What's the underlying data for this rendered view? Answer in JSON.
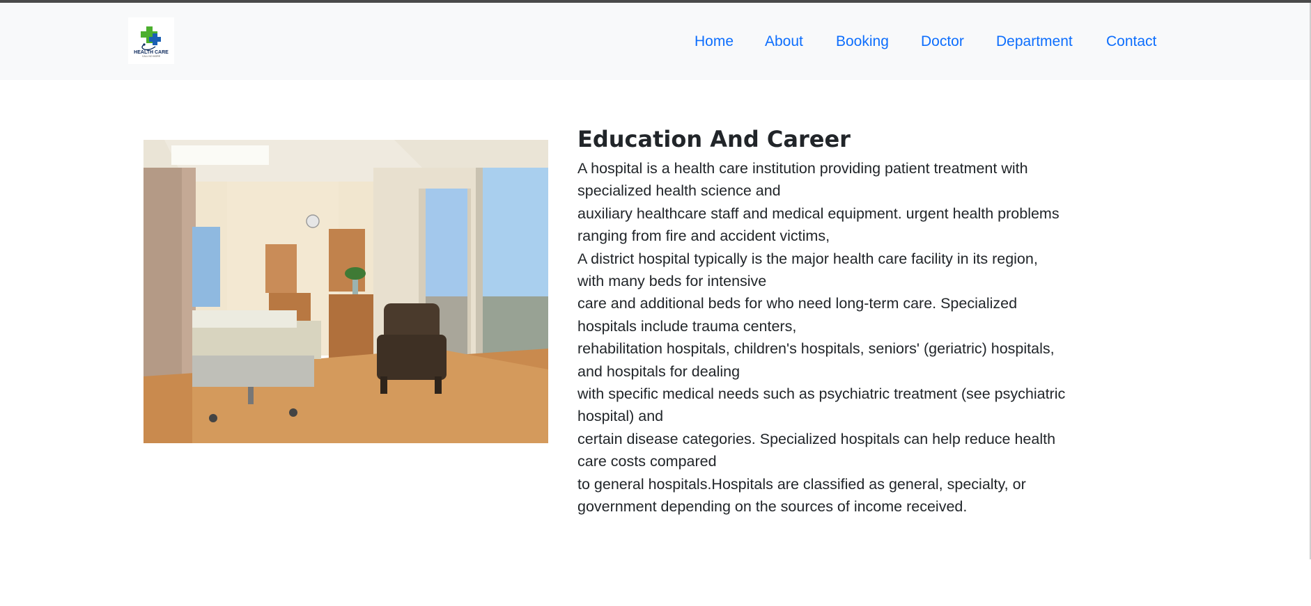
{
  "brand": {
    "logo_text": "HEALTH CARE",
    "logo_tagline": "CALL NO MORE",
    "colors": {
      "green": "#4caf2e",
      "blue": "#1a5fb4",
      "navy": "#0d2a5c"
    }
  },
  "nav": {
    "items": [
      {
        "label": "Home"
      },
      {
        "label": "About"
      },
      {
        "label": "Booking"
      },
      {
        "label": "Doctor"
      },
      {
        "label": "Department"
      },
      {
        "label": "Contact"
      }
    ],
    "link_color": "#0d6efd"
  },
  "section": {
    "image_subject": "hospital-patient-room",
    "title": "Education And Career",
    "lines": [
      "A hospital is a health care institution providing patient treatment with",
      "specialized health science and",
      "auxiliary healthcare staff and medical equipment. urgent health problems",
      "ranging from fire and accident victims,",
      "A district hospital typically is the major health care facility in its region,",
      "with many beds for intensive",
      "care and additional beds for who need long-term care. Specialized",
      "hospitals include trauma centers,",
      "rehabilitation hospitals, children's hospitals, seniors' (geriatric) hospitals,",
      "and hospitals for dealing",
      "with specific medical needs such as psychiatric treatment (see psychiatric",
      "hospital) and",
      "certain disease categories. Specialized hospitals can help reduce health",
      "care costs compared",
      "to general hospitals.Hospitals are classified as general, specialty, or",
      "government depending on the sources of income received."
    ]
  }
}
